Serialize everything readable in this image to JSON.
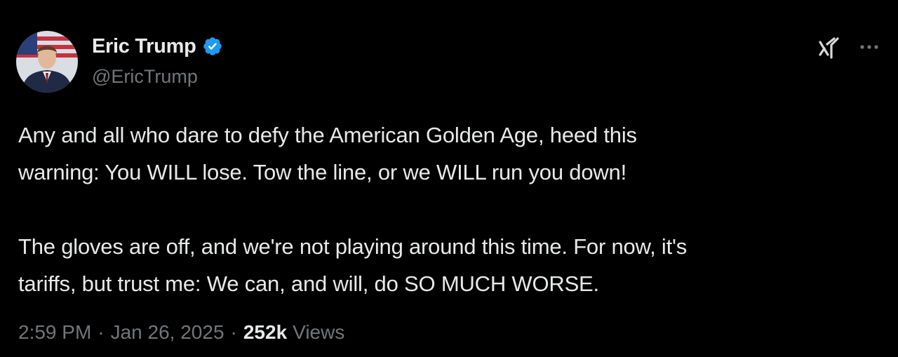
{
  "tweet": {
    "author": {
      "display_name": "Eric Trump",
      "handle": "@EricTrump",
      "verified": true
    },
    "paragraphs": [
      "Any and all who dare to defy the American Golden Age, heed this\nwarning: You WILL lose. Tow the line, or we WILL run you down!",
      "The gloves are off, and we're not playing around this time. For now, it's\ntariffs, but trust me: We can, and will, do SO MUCH WORSE."
    ],
    "meta": {
      "time": "2:59 PM",
      "separator": "·",
      "date": "Jan 26, 2025",
      "views_count": "252k",
      "views_label": "Views"
    }
  },
  "icons": {
    "verified": "verified-badge-icon",
    "grok": "grok-icon",
    "more": "more-options-icon"
  },
  "colors": {
    "background": "#000000",
    "primary_text": "#e7e9ea",
    "secondary_text": "#71767b",
    "verified_blue": "#1d9bf0"
  }
}
